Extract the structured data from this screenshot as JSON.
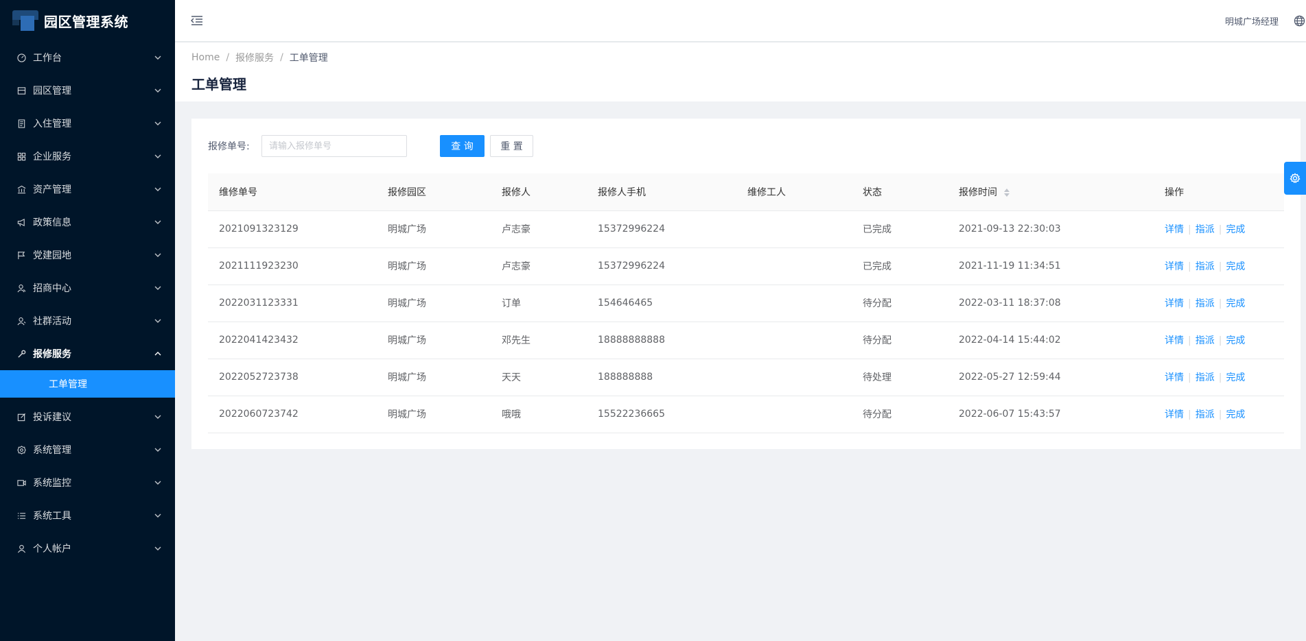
{
  "app": {
    "title": "园区管理系统"
  },
  "colors": {
    "sidebar_bg": "#001529",
    "accent": "#1890ff",
    "page_bg": "#f0f2f5"
  },
  "sidebar": {
    "items": [
      {
        "label": "工作台",
        "icon": "dashboard-icon"
      },
      {
        "label": "园区管理",
        "icon": "building-icon"
      },
      {
        "label": "入住管理",
        "icon": "document-icon"
      },
      {
        "label": "企业服务",
        "icon": "grid-icon"
      },
      {
        "label": "资产管理",
        "icon": "bank-icon"
      },
      {
        "label": "政策信息",
        "icon": "megaphone-icon"
      },
      {
        "label": "党建园地",
        "icon": "flag-icon"
      },
      {
        "label": "招商中心",
        "icon": "users-icon"
      },
      {
        "label": "社群活动",
        "icon": "team-icon"
      },
      {
        "label": "报修服务",
        "icon": "wrench-icon",
        "open": true
      },
      {
        "label": "投诉建议",
        "icon": "edit-icon"
      },
      {
        "label": "系统管理",
        "icon": "gear-icon"
      },
      {
        "label": "系统监控",
        "icon": "camera-icon"
      },
      {
        "label": "系统工具",
        "icon": "list-icon"
      },
      {
        "label": "个人帐户",
        "icon": "user-icon"
      }
    ],
    "active_submenu": "工单管理"
  },
  "header": {
    "username": "明城广场经理"
  },
  "breadcrumb": [
    "Home",
    "报修服务",
    "工单管理"
  ],
  "page_title": "工单管理",
  "search": {
    "label": "报修单号:",
    "placeholder": "请输入报修单号",
    "value": "",
    "query_label": "查 询",
    "reset_label": "重 置"
  },
  "table": {
    "columns": [
      "维修单号",
      "报修园区",
      "报修人",
      "报修人手机",
      "维修工人",
      "状态",
      "报修时间",
      "操作"
    ],
    "rows": [
      {
        "no": "2021091323129",
        "park": "明城广场",
        "reporter": "卢志豪",
        "phone": "15372996224",
        "worker": "",
        "status": "已完成",
        "time": "2021-09-13 22:30:03"
      },
      {
        "no": "2021111923230",
        "park": "明城广场",
        "reporter": "卢志豪",
        "phone": "15372996224",
        "worker": "",
        "status": "已完成",
        "time": "2021-11-19 11:34:51"
      },
      {
        "no": "2022031123331",
        "park": "明城广场",
        "reporter": "订单",
        "phone": "154646465",
        "worker": "",
        "status": "待分配",
        "time": "2022-03-11 18:37:08"
      },
      {
        "no": "2022041423432",
        "park": "明城广场",
        "reporter": "邓先生",
        "phone": "18888888888",
        "worker": "",
        "status": "待分配",
        "time": "2022-04-14 15:44:02"
      },
      {
        "no": "2022052723738",
        "park": "明城广场",
        "reporter": "天天",
        "phone": "188888888",
        "worker": "",
        "status": "待处理",
        "time": "2022-05-27 12:59:44"
      },
      {
        "no": "2022060723742",
        "park": "明城广场",
        "reporter": "哦哦",
        "phone": "15522236665",
        "worker": "",
        "status": "待分配",
        "time": "2022-06-07 15:43:57"
      }
    ],
    "actions": [
      "详情",
      "指派",
      "完成"
    ]
  }
}
